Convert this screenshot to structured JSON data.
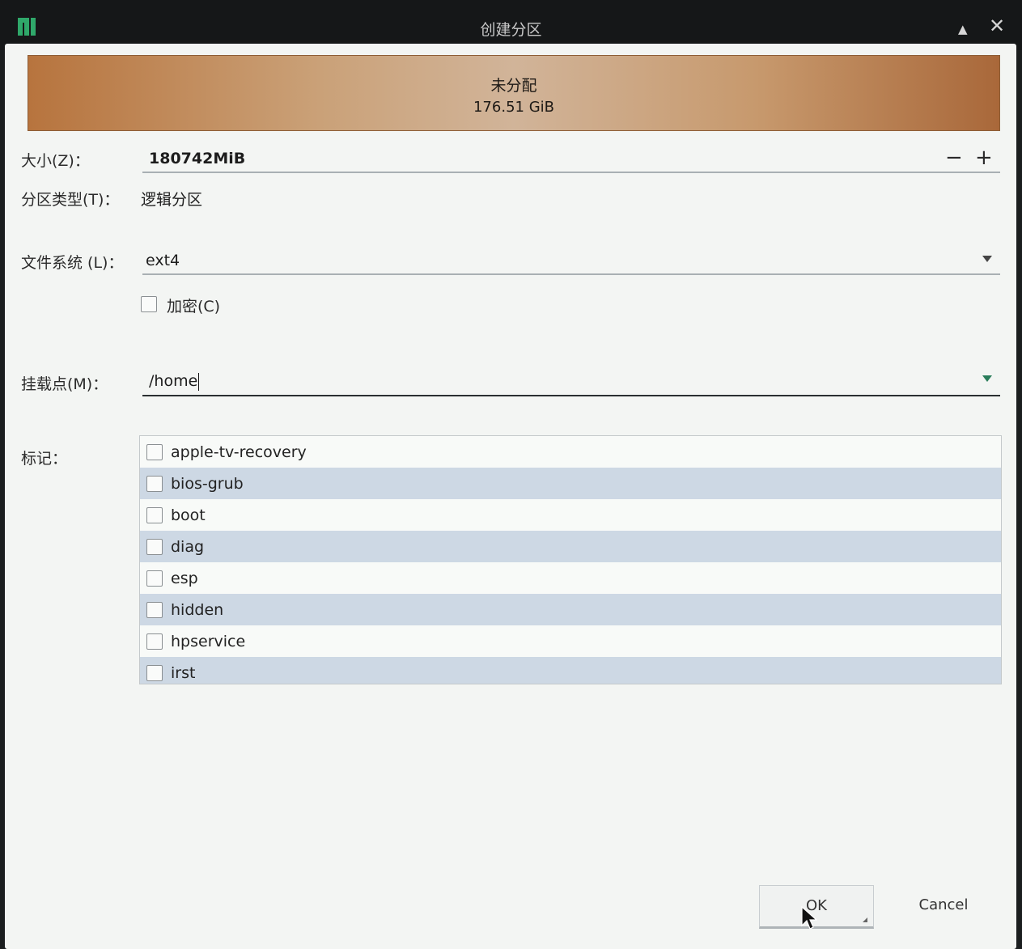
{
  "window": {
    "title": "创建分区",
    "up_glyph": "▲",
    "close_glyph": "✕"
  },
  "partition_bar": {
    "name": "未分配",
    "size": "176.51 GiB"
  },
  "form": {
    "size_label": "大小(Z)：",
    "size_value": "180742MiB",
    "minus": "−",
    "plus": "+",
    "type_label": "分区类型(T)：",
    "type_value": "逻辑分区",
    "fs_label": "文件系统 (L)：",
    "fs_value": "ext4",
    "encrypt_label": "加密(C)",
    "mount_label": "挂载点(M)：",
    "mount_value": "/home",
    "flags_label": "标记："
  },
  "flags": [
    {
      "label": "apple-tv-recovery",
      "checked": false
    },
    {
      "label": "bios-grub",
      "checked": false
    },
    {
      "label": "boot",
      "checked": false
    },
    {
      "label": "diag",
      "checked": false
    },
    {
      "label": "esp",
      "checked": false
    },
    {
      "label": "hidden",
      "checked": false
    },
    {
      "label": "hpservice",
      "checked": false
    },
    {
      "label": "irst",
      "checked": false
    }
  ],
  "buttons": {
    "ok": "OK",
    "cancel": "Cancel"
  }
}
